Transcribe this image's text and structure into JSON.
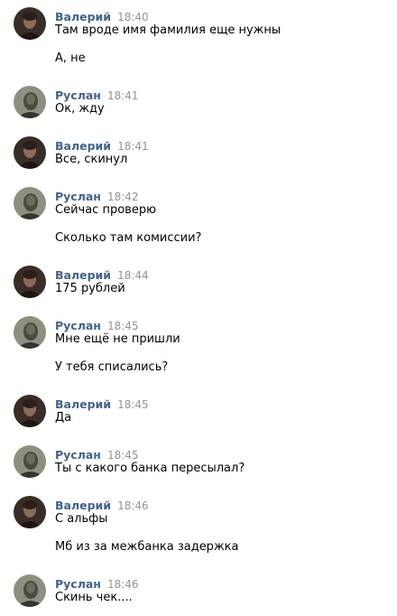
{
  "messages": [
    {
      "author": "Валерий",
      "time": "18:40",
      "avatar": "valery-avatar",
      "lines": [
        "Там вроде имя фамилия еще нужны",
        "А, не"
      ]
    },
    {
      "author": "Руслан",
      "time": "18:41",
      "avatar": "ruslan-avatar",
      "lines": [
        "Ок, жду"
      ]
    },
    {
      "author": "Валерий",
      "time": "18:41",
      "avatar": "valery-avatar",
      "lines": [
        "Все, скинул"
      ]
    },
    {
      "author": "Руслан",
      "time": "18:42",
      "avatar": "ruslan-avatar",
      "lines": [
        "Сейчас проверю",
        "Сколько там комиссии?"
      ]
    },
    {
      "author": "Валерий",
      "time": "18:44",
      "avatar": "valery-avatar",
      "lines": [
        "175 рублей"
      ]
    },
    {
      "author": "Руслан",
      "time": "18:45",
      "avatar": "ruslan-avatar",
      "lines": [
        "Мне ещё не пришли",
        "У тебя списались?"
      ]
    },
    {
      "author": "Валерий",
      "time": "18:45",
      "avatar": "valery-avatar",
      "lines": [
        "Да"
      ]
    },
    {
      "author": "Руслан",
      "time": "18:45",
      "avatar": "ruslan-avatar",
      "lines": [
        "Ты с какого банка пересылал?"
      ]
    },
    {
      "author": "Валерий",
      "time": "18:46",
      "avatar": "valery-avatar",
      "lines": [
        "С альфы",
        "Мб из за межбанка задержка"
      ]
    },
    {
      "author": "Руслан",
      "time": "18:46",
      "avatar": "ruslan-avatar",
      "lines": [
        "Скинь чек...."
      ]
    }
  ],
  "colors": {
    "author": "#42648b",
    "time": "#939393",
    "text": "#000000",
    "background": "#ffffff"
  }
}
